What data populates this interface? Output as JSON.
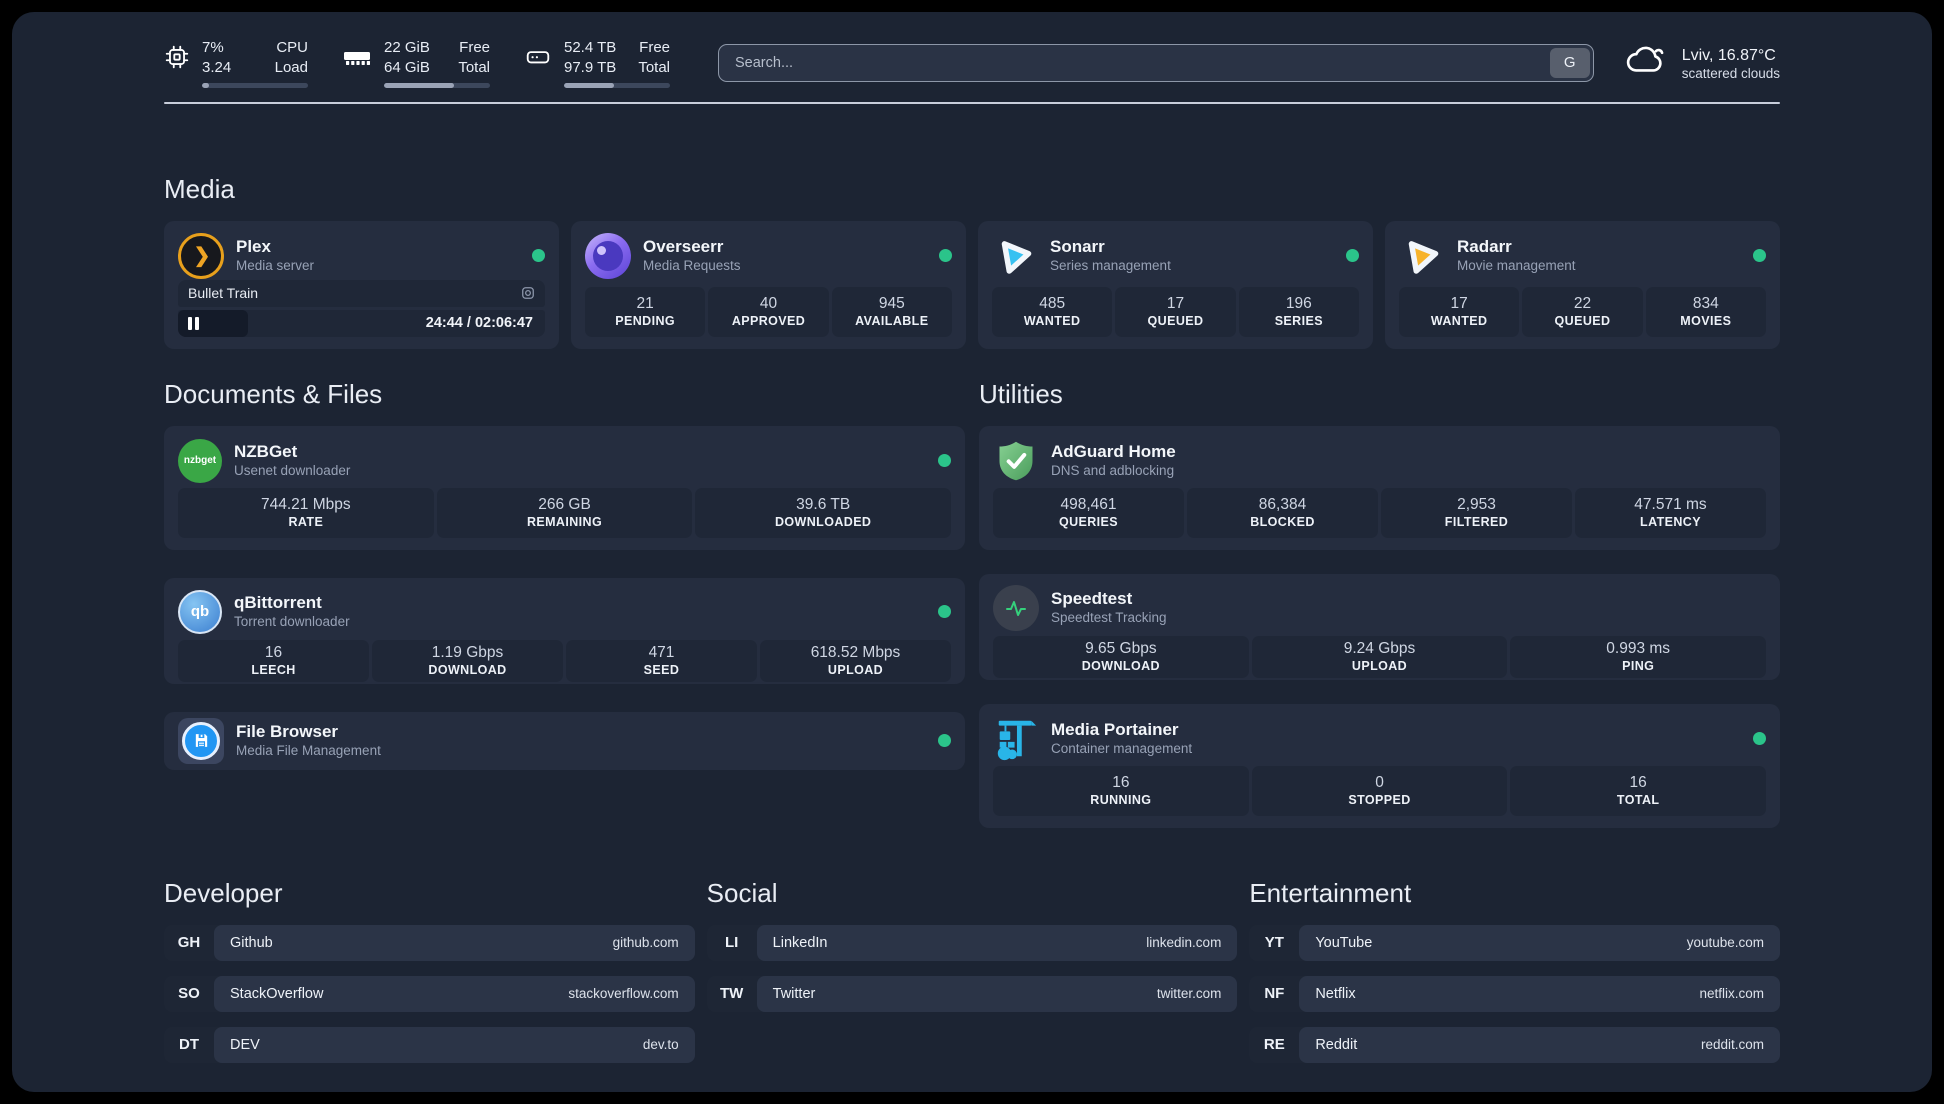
{
  "colors": {
    "background": "#1c2433",
    "card": "#252d3f",
    "tile": "#1f2737",
    "status_online": "#2bc48a",
    "accent_plex": "#e8a01c",
    "accent_overseerr": "#7c5ce8",
    "accent_sonarr": "#38c1f1",
    "accent_radarr": "#f7b32b",
    "accent_nzbget": "#3aa746",
    "accent_qbittorrent": "#4a90d9",
    "accent_adguard": "#67b279",
    "accent_speedtest": "#35d17c",
    "accent_portainer": "#29b5e8",
    "accent_filebrowser": "#2196f3"
  },
  "header": {
    "system_stats": [
      {
        "icon": "cpu-icon",
        "values": [
          "7%",
          "3.24"
        ],
        "labels": [
          "CPU",
          "Load"
        ],
        "bar_percent": 7
      },
      {
        "icon": "ram-icon",
        "values": [
          "22 GiB",
          "64 GiB"
        ],
        "labels": [
          "Free",
          "Total"
        ],
        "bar_percent": 66
      },
      {
        "icon": "disk-icon",
        "values": [
          "52.4 TB",
          "97.9 TB"
        ],
        "labels": [
          "Free",
          "Total"
        ],
        "bar_percent": 47
      }
    ],
    "search": {
      "placeholder": "Search...",
      "provider_button": "G"
    },
    "weather": {
      "icon": "cloud-icon",
      "title": "Lviv, 16.87°C",
      "subtitle": "scattered clouds"
    }
  },
  "sections": {
    "media": {
      "title": "Media",
      "plex": {
        "title": "Plex",
        "subtitle": "Media server",
        "status": "online",
        "now_playing": {
          "title": "Bullet Train",
          "time": "24:44 / 02:06:47",
          "progress_percent": 19
        }
      },
      "overseerr": {
        "title": "Overseerr",
        "subtitle": "Media Requests",
        "status": "online",
        "stats": [
          {
            "value": "21",
            "label": "PENDING"
          },
          {
            "value": "40",
            "label": "APPROVED"
          },
          {
            "value": "945",
            "label": "AVAILABLE"
          }
        ]
      },
      "sonarr": {
        "title": "Sonarr",
        "subtitle": "Series management",
        "status": "online",
        "stats": [
          {
            "value": "485",
            "label": "WANTED"
          },
          {
            "value": "17",
            "label": "QUEUED"
          },
          {
            "value": "196",
            "label": "SERIES"
          }
        ]
      },
      "radarr": {
        "title": "Radarr",
        "subtitle": "Movie management",
        "status": "online",
        "stats": [
          {
            "value": "17",
            "label": "WANTED"
          },
          {
            "value": "22",
            "label": "QUEUED"
          },
          {
            "value": "834",
            "label": "MOVIES"
          }
        ]
      }
    },
    "documents": {
      "title": "Documents & Files",
      "nzbget": {
        "title": "NZBGet",
        "subtitle": "Usenet downloader",
        "status": "online",
        "icon_text": "nzbget",
        "stats": [
          {
            "value": "744.21 Mbps",
            "label": "RATE"
          },
          {
            "value": "266 GB",
            "label": "REMAINING"
          },
          {
            "value": "39.6 TB",
            "label": "DOWNLOADED"
          }
        ]
      },
      "qbittorrent": {
        "title": "qBittorrent",
        "subtitle": "Torrent downloader",
        "status": "online",
        "icon_text": "qb",
        "stats": [
          {
            "value": "16",
            "label": "LEECH"
          },
          {
            "value": "1.19 Gbps",
            "label": "DOWNLOAD"
          },
          {
            "value": "471",
            "label": "SEED"
          },
          {
            "value": "618.52 Mbps",
            "label": "UPLOAD"
          }
        ]
      },
      "filebrowser": {
        "title": "File Browser",
        "subtitle": "Media File Management",
        "status": "online"
      }
    },
    "utilities": {
      "title": "Utilities",
      "adguard": {
        "title": "AdGuard Home",
        "subtitle": "DNS and adblocking",
        "stats": [
          {
            "value": "498,461",
            "label": "QUERIES"
          },
          {
            "value": "86,384",
            "label": "BLOCKED"
          },
          {
            "value": "2,953",
            "label": "FILTERED"
          },
          {
            "value": "47.571 ms",
            "label": "LATENCY"
          }
        ]
      },
      "speedtest": {
        "title": "Speedtest",
        "subtitle": "Speedtest Tracking",
        "stats": [
          {
            "value": "9.65 Gbps",
            "label": "DOWNLOAD"
          },
          {
            "value": "9.24 Gbps",
            "label": "UPLOAD"
          },
          {
            "value": "0.993 ms",
            "label": "PING"
          }
        ]
      },
      "portainer": {
        "title": "Media Portainer",
        "subtitle": "Container management",
        "status": "online",
        "stats": [
          {
            "value": "16",
            "label": "RUNNING"
          },
          {
            "value": "0",
            "label": "STOPPED"
          },
          {
            "value": "16",
            "label": "TOTAL"
          }
        ]
      }
    },
    "bookmarks": [
      {
        "title": "Developer",
        "links": [
          {
            "abbr": "GH",
            "name": "Github",
            "url": "github.com"
          },
          {
            "abbr": "SO",
            "name": "StackOverflow",
            "url": "stackoverflow.com"
          },
          {
            "abbr": "DT",
            "name": "DEV",
            "url": "dev.to"
          }
        ]
      },
      {
        "title": "Social",
        "links": [
          {
            "abbr": "LI",
            "name": "LinkedIn",
            "url": "linkedin.com"
          },
          {
            "abbr": "TW",
            "name": "Twitter",
            "url": "twitter.com"
          }
        ]
      },
      {
        "title": "Entertainment",
        "links": [
          {
            "abbr": "YT",
            "name": "YouTube",
            "url": "youtube.com"
          },
          {
            "abbr": "NF",
            "name": "Netflix",
            "url": "netflix.com"
          },
          {
            "abbr": "RE",
            "name": "Reddit",
            "url": "reddit.com"
          }
        ]
      }
    ]
  }
}
